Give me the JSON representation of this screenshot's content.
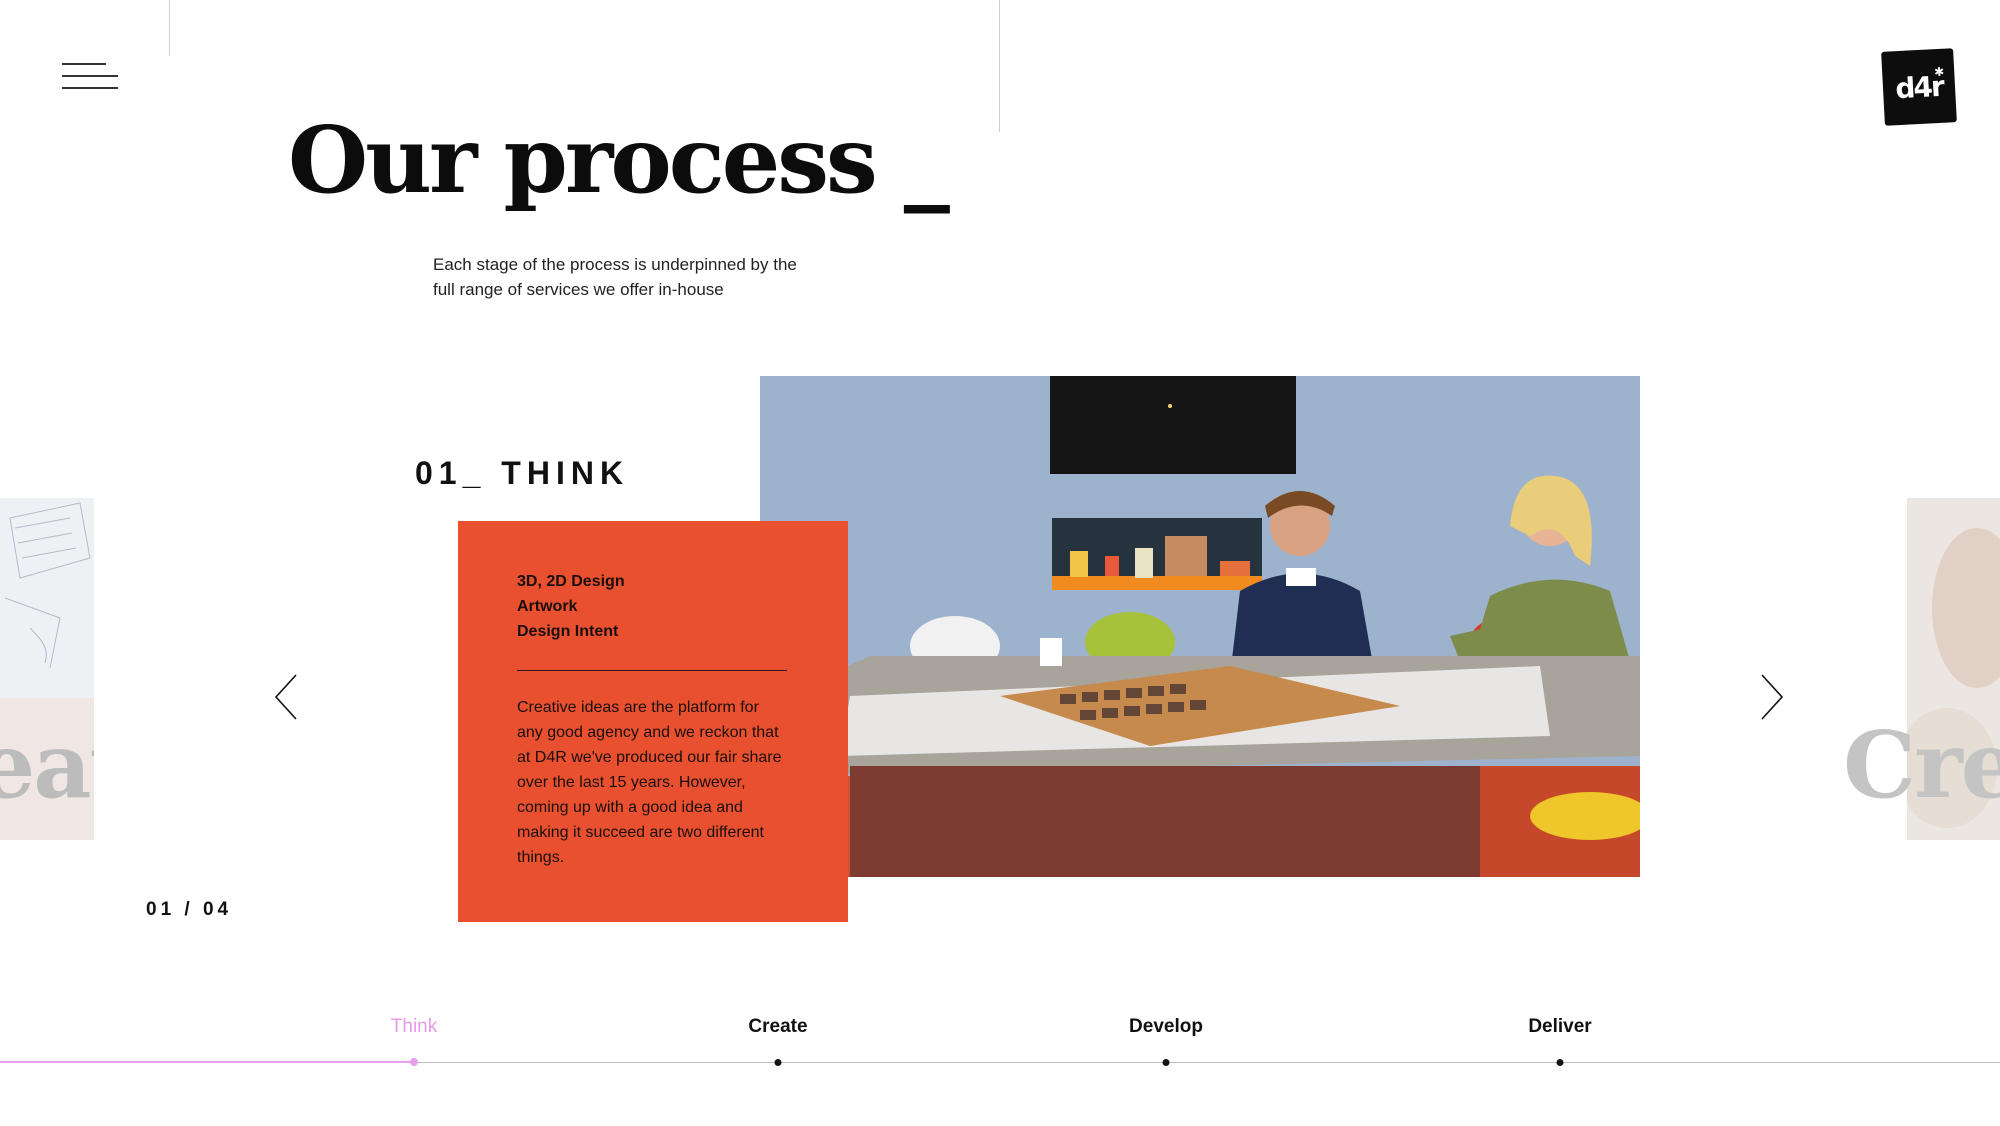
{
  "header": {
    "menu_icon": "hamburger-icon",
    "logo_text": "d4r"
  },
  "page": {
    "title": "Our process _",
    "subtitle": "Each stage of the process is underpinned by the full range of services we offer in-house"
  },
  "slide": {
    "heading": "01_ THINK",
    "services": [
      "3D, 2D Design",
      "Artwork",
      "Design Intent"
    ],
    "body": "Creative ideas are the platform for any good agency and we reckon that at D4R we've produced our fair share over the last 15 years. However, coming up with a good idea and making it succeed are two different things.",
    "counter": "01 / 04",
    "prev_icon": "chevron-left-icon",
    "next_icon": "chevron-right-icon",
    "card_color": "#e8502f"
  },
  "adjacent_slides": {
    "left_label": "eate",
    "right_label": "Crea"
  },
  "timeline": {
    "steps": [
      {
        "label": "Think",
        "active": true
      },
      {
        "label": "Create",
        "active": false
      },
      {
        "label": "Develop",
        "active": false
      },
      {
        "label": "Deliver",
        "active": false
      }
    ],
    "active_color": "#e79ae9"
  }
}
